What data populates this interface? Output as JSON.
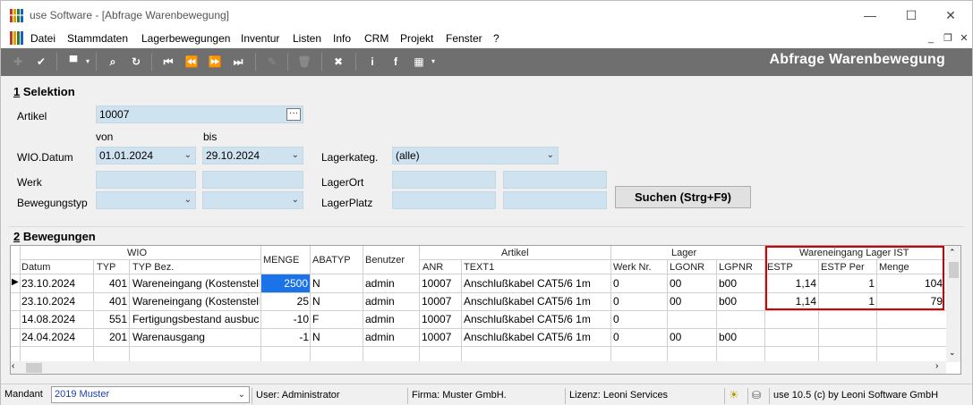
{
  "window": {
    "title": "use Software - [Abfrage Warenbewegung]"
  },
  "menu": [
    "Datei",
    "Stammdaten",
    "Lagerbewegungen",
    "Inventur",
    "Listen",
    "Info",
    "CRM",
    "Projekt",
    "Fenster",
    "?"
  ],
  "form_title": "Abfrage Warenbewegung",
  "selektion": {
    "title_num": "1",
    "title_text": " Selektion",
    "artikel_label": "Artikel",
    "artikel_value": "10007",
    "von_label": "von",
    "bis_label": "bis",
    "wio_label": "WIO.Datum",
    "wio_von": "01.01.2024",
    "wio_bis": "29.10.2024",
    "lagerkateg_label": "Lagerkateg.",
    "lagerkateg_value": "(alle)",
    "werk_label": "Werk",
    "lagerort_label": "LagerOrt",
    "bewegungstyp_label": "Bewegungstyp",
    "lagerplatz_label": "LagerPlatz",
    "search_label": "Suchen (Strg+F9)"
  },
  "bewegungen": {
    "title_num": "2",
    "title_text": " Bewegungen",
    "groups": {
      "wio": "WIO",
      "artikel": "Artikel",
      "lager": "Lager",
      "wareneingang": "Wareneingang Lager IST"
    },
    "columns": [
      "Datum",
      "TYP",
      "TYP Bez.",
      "MENGE",
      "ABATYP",
      "Benutzer",
      "ANR",
      "TEXT1",
      "Werk Nr.",
      "LGONR",
      "LGPNR",
      "ESTP",
      "ESTP Per",
      "Menge"
    ],
    "rows": [
      [
        "23.10.2024",
        "401",
        "Wareneingang (Kostenstelle)",
        "2500",
        "N",
        "admin",
        "10007",
        "Anschlußkabel CAT5/6 1m",
        "0",
        "00",
        "b00",
        "1,14",
        "1",
        "104"
      ],
      [
        "23.10.2024",
        "401",
        "Wareneingang (Kostenstelle)",
        "25",
        "N",
        "admin",
        "10007",
        "Anschlußkabel CAT5/6 1m",
        "0",
        "00",
        "b00",
        "1,14",
        "1",
        "79"
      ],
      [
        "14.08.2024",
        "551",
        "Fertigungsbestand ausbuchen",
        "-10",
        "F",
        "admin",
        "10007",
        "Anschlußkabel CAT5/6 1m",
        "0",
        "",
        "",
        "",
        "",
        ""
      ],
      [
        "24.04.2024",
        "201",
        "Warenausgang",
        "-1",
        "N",
        "admin",
        "10007",
        "Anschlußkabel CAT5/6 1m",
        "0",
        "00",
        "b00",
        "",
        "",
        ""
      ]
    ]
  },
  "status": {
    "mandant_label": "Mandant",
    "mandant_value": "2019 Muster",
    "user": "User: Administrator",
    "firma": "Firma: Muster GmbH.",
    "lizenz": "Lizenz: Leoni Services",
    "version": "use 10.5 (c) by Leoni Software GmbH"
  }
}
